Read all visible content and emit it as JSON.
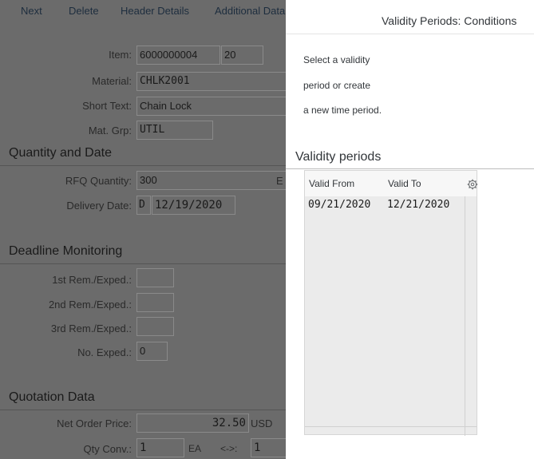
{
  "toolbar": {
    "next": "Next",
    "delete": "Delete",
    "header_details": "Header Details",
    "additional_data": "Additional Data"
  },
  "item": {
    "label": "Item:",
    "number": "6000000004",
    "position": "20"
  },
  "material": {
    "label": "Material:",
    "value": "CHLK2001"
  },
  "short_text": {
    "label": "Short Text:",
    "value": "Chain Lock"
  },
  "mat_grp": {
    "label": "Mat. Grp:",
    "value": "UTIL"
  },
  "quantity_and_date": {
    "title": "Quantity and Date",
    "rfq_label": "RFQ Quantity:",
    "rfq_value": "300",
    "rfq_unit": "E",
    "delivery_label": "Delivery Date:",
    "delivery_type": "D",
    "delivery_value": "12/19/2020"
  },
  "deadline": {
    "title": "Deadline Monitoring",
    "rem1": "1st Rem./Exped.:",
    "rem2": "2nd Rem./Exped.:",
    "rem3": "3rd Rem./Exped.:",
    "no_exped_label": "No. Exped.:",
    "no_exped_value": "0"
  },
  "quotation": {
    "title": "Quotation Data",
    "net_price_label": "Net Order Price:",
    "net_price_value": "32.50",
    "currency": "USD",
    "qty_conv_label": "Qty Conv.:",
    "qty_conv_value": "1",
    "qty_conv_unit": "EA",
    "arrow": "<->:",
    "qty_conv_value2": "1"
  },
  "dialog": {
    "title": "Validity Periods: Conditions",
    "instruction_lines": [
      "Select a validity",
      "period or create",
      "a new time period."
    ],
    "section_title": "Validity periods",
    "columns": {
      "valid_from": "Valid From",
      "valid_to": "Valid To"
    },
    "rows": [
      {
        "valid_from": "09/21/2020",
        "valid_to": "12/21/2020"
      }
    ],
    "settings_icon": "gear-icon"
  }
}
